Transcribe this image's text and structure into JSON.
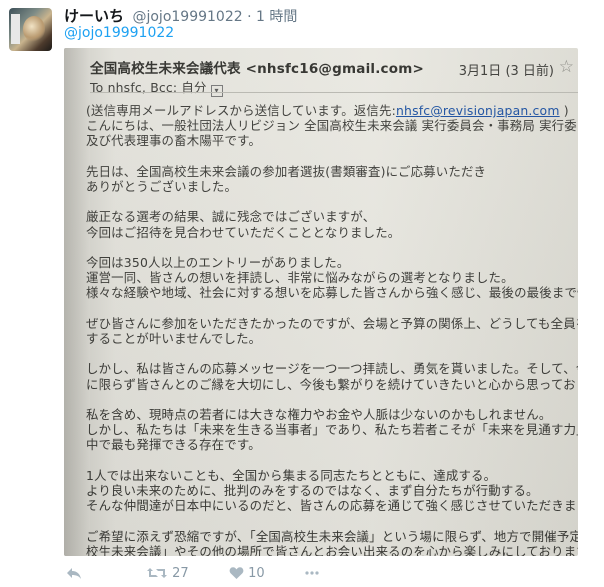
{
  "tweet": {
    "display_name": "けーいち",
    "handle": "@jojo19991022",
    "separator": "·",
    "time": "1 時間",
    "reply_to": "@jojo19991022"
  },
  "email": {
    "sender": "全国高校生未来会議代表 <nhsfc16@gmail.com>",
    "date": "3月1日 (3 日前)",
    "to_line": "To nhsfc, Bcc: 自分",
    "body_lines": [
      "(送信専用メールアドレスから送信しています。返信先:",
      "こんにちは、一般社団法人リビジョン 全国高校生未来会議 実行委員会・事務局 実行委",
      "及び代表理事の畜木陽平です。",
      "",
      "先日は、全国高校生未来会議の参加者選抜(書類審査)にご応募いただき",
      "ありがとうございました。",
      "",
      "厳正なる選考の結果、誠に残念ではございますが、",
      "今回はご招待を見合わせていただくこととなりました。",
      "",
      "今回は350人以上のエントリーがありました。",
      "運営一同、皆さんの想いを拝読し、非常に悩みながらの選考となりました。",
      "様々な経験や地域、社会に対する想いを応募した皆さんから強く感じ、最後の最後まで悩み",
      "",
      "ぜひ皆さんに参加をいただきたかったのですが、会場と予算の関係上、どうしても全員をご招",
      "することが叶いませんでした。",
      "",
      "しかし、私は皆さんの応募メッセージを一つ一つ拝読し、勇気を貰いました。そして、今回の会",
      "に限らず皆さんとのご縁を大切にし、今後も繋がりを続けていきたいと心から思っております",
      "",
      "私を含め、現時点の若者には大きな権力やお金や人脈は少ないのかもしれません。",
      "しかし、私たちは「未来を生きる当事者」であり、私たち若者こそが「未来を見通す力」を社会に",
      "中で最も発揮できる存在です。",
      "",
      "1人では出来ないことも、全国から集まる同志たちとともに、達成する。",
      "より良い未来のために、批判のみをするのではなく、まず自分たちが行動する。",
      "そんな仲間達が日本中にいるのだと、皆さんの応募を通じて強く感じさせていただきました。",
      "",
      "ご希望に添えず恐縮ですが、「全国高校生未来会議」という場に限らず、地方で開催予定の「",
      "校生未来会議」やその他の場所で皆さんとお会い出来るのを心から楽しみにしております。で"
    ],
    "reply_address": "nhsfc@revisionjapan.com",
    "reply_close": " )"
  },
  "actions": {
    "retweet_count": "27",
    "like_count": "10"
  }
}
